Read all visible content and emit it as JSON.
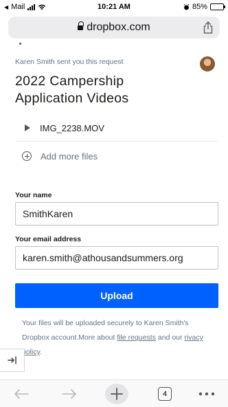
{
  "status_bar": {
    "back_app": "Mail",
    "time": "10:21 AM",
    "battery": "85%",
    "battery_level": 0.85
  },
  "browser": {
    "url": "dropbox.com"
  },
  "request": {
    "sender_text": "Karen Smith sent you this request",
    "title": "2022 Campership Application Videos"
  },
  "files": [
    {
      "name": "IMG_2238.MOV"
    }
  ],
  "add_more_label": "Add more files",
  "form": {
    "name_label": "Your name",
    "name_value": "SmithKaren",
    "email_label": "Your email address",
    "email_value": "karen.smith@athousandsummers.org",
    "upload_label": "Upload"
  },
  "footer": {
    "text_1": "Your files will be uploaded securely to Karen Smith's Dropbox account.More about ",
    "link_1": "file requests",
    "text_2": " and our ",
    "link_2_visible": "rivacy policy",
    "text_3": "."
  },
  "toolbar": {
    "tab_count": "4"
  },
  "colors": {
    "primary": "#0061fe",
    "muted_text": "#637282"
  }
}
